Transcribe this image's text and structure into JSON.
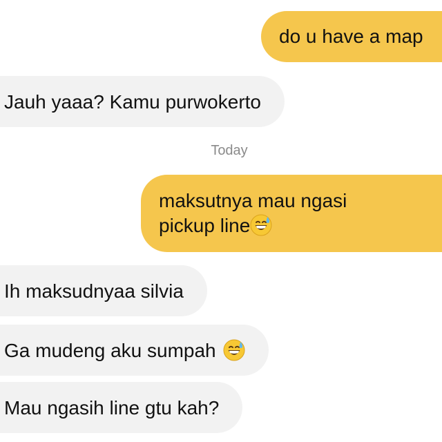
{
  "messages": [
    {
      "direction": "sent",
      "text": "do u have a map"
    },
    {
      "direction": "received",
      "text": "Jauh yaaa? Kamu purwokerto"
    },
    {
      "direction": "sent",
      "line1": "maksutnya mau ngasi",
      "line2": "pickup line",
      "emoji": "grinning-sweat-emoji"
    },
    {
      "direction": "received",
      "text": "Ih maksudnyaa silvia"
    },
    {
      "direction": "received",
      "text": "Ga mudeng aku sumpah",
      "emoji": "grinning-sweat-emoji"
    },
    {
      "direction": "received",
      "text": "Mau ngasih line gtu kah?"
    }
  ],
  "divider": {
    "label": "Today"
  },
  "colors": {
    "sent_bubble": "#f5c64d",
    "received_bubble": "#f2f2f2",
    "timestamp_text": "#8a8a8a"
  }
}
